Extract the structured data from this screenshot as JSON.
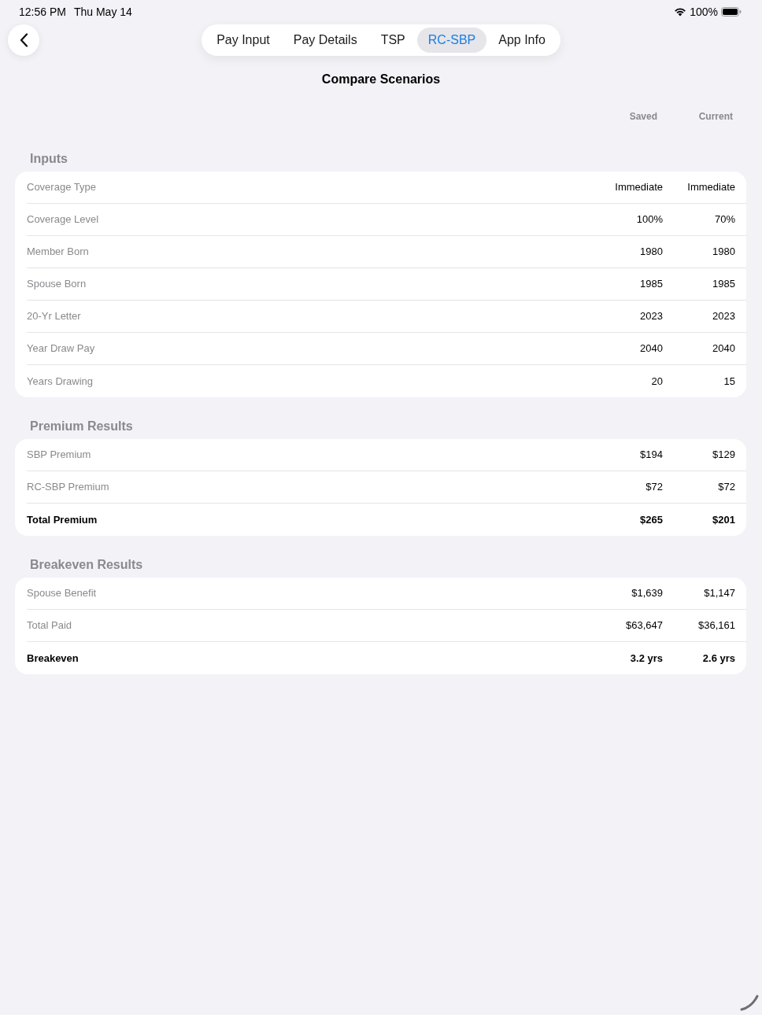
{
  "status_bar": {
    "time": "12:56 PM",
    "date": "Thu May 14",
    "battery": "100%"
  },
  "tabs": [
    {
      "label": "Pay Input",
      "selected": false
    },
    {
      "label": "Pay Details",
      "selected": false
    },
    {
      "label": "TSP",
      "selected": false
    },
    {
      "label": "RC-SBP",
      "selected": true
    },
    {
      "label": "App Info",
      "selected": false
    }
  ],
  "title": "Compare Scenarios",
  "columns": [
    "Saved",
    "Current"
  ],
  "sections": [
    {
      "title": "Inputs",
      "rows": [
        {
          "kind": "detail",
          "label": "Coverage Type",
          "values": [
            "Immediate",
            "Immediate"
          ]
        },
        {
          "kind": "detail",
          "label": "Coverage Level",
          "values": [
            "100%",
            "70%"
          ]
        },
        {
          "kind": "detail",
          "label": "Member Born",
          "values": [
            "1980",
            "1980"
          ]
        },
        {
          "kind": "detail",
          "label": "Spouse Born",
          "values": [
            "1985",
            "1985"
          ]
        },
        {
          "kind": "detail",
          "label": "20-Yr Letter",
          "values": [
            "2023",
            "2023"
          ]
        },
        {
          "kind": "detail",
          "label": "Year Draw Pay",
          "values": [
            "2040",
            "2040"
          ]
        },
        {
          "kind": "detail",
          "label": "Years Drawing",
          "values": [
            "20",
            "15"
          ]
        }
      ]
    },
    {
      "title": "Premium Results",
      "rows": [
        {
          "kind": "detail",
          "label": "SBP Premium",
          "values": [
            "$194",
            "$129"
          ]
        },
        {
          "kind": "detail",
          "label": "RC-SBP Premium",
          "values": [
            "$72",
            "$72"
          ]
        },
        {
          "kind": "total",
          "label": "Total Premium",
          "values": [
            "$265",
            "$201"
          ]
        }
      ]
    },
    {
      "title": "Breakeven Results",
      "rows": [
        {
          "kind": "detail",
          "label": "Spouse Benefit",
          "values": [
            "$1,639",
            "$1,147"
          ]
        },
        {
          "kind": "detail",
          "label": "Total Paid",
          "values": [
            "$63,647",
            "$36,161"
          ]
        },
        {
          "kind": "total",
          "label": "Breakeven",
          "values": [
            "3.2 yrs",
            "2.6 yrs"
          ]
        }
      ]
    }
  ]
}
